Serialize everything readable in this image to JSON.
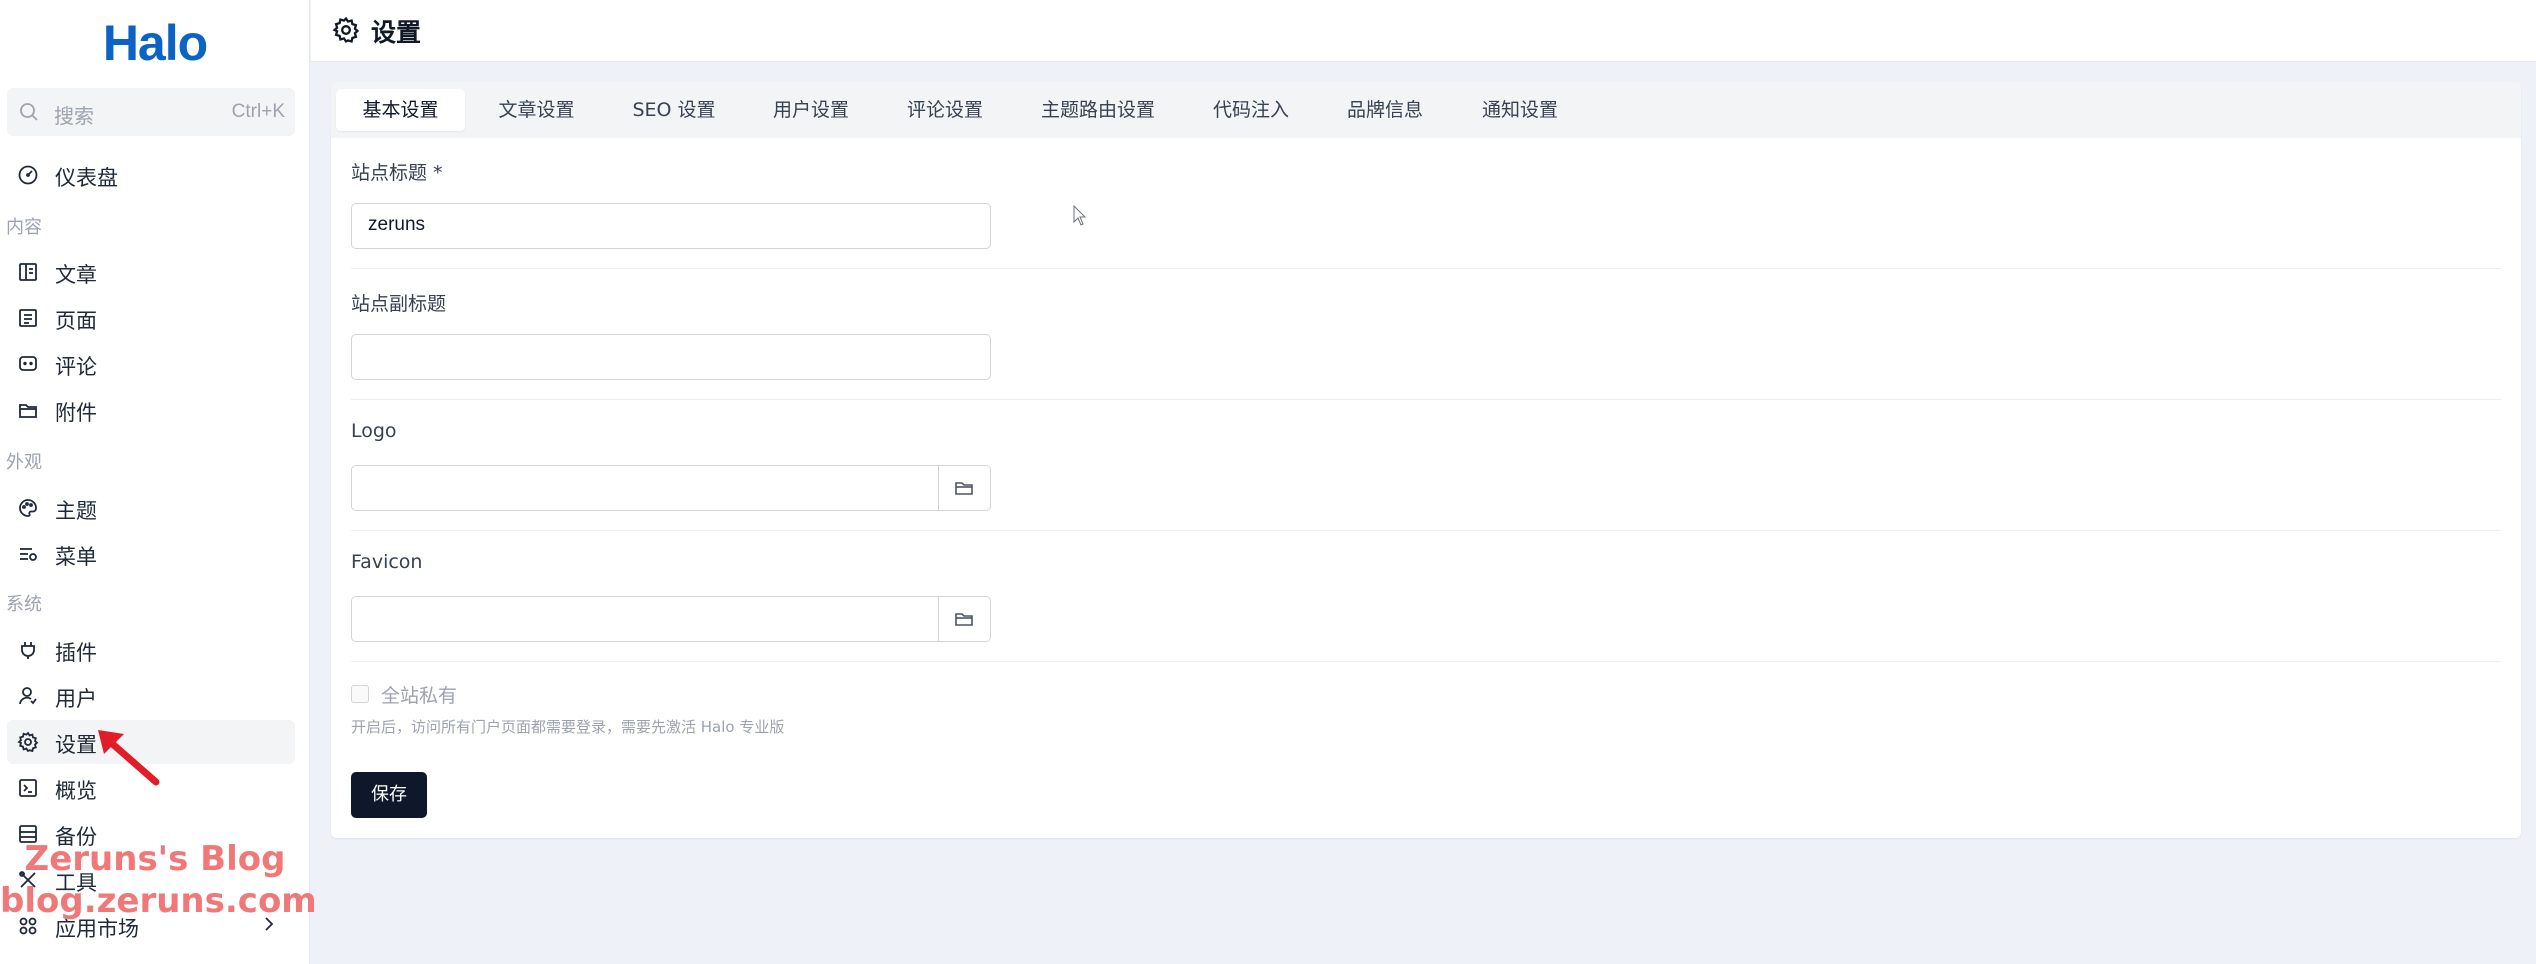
{
  "app": {
    "logo": "Halo"
  },
  "search": {
    "placeholder": "搜索",
    "shortcut": "Ctrl+K"
  },
  "sidebar": {
    "dashboard": {
      "label": "仪表盘",
      "icon": "dashboard-icon"
    },
    "groups": {
      "content": "内容",
      "appearance": "外观",
      "system": "系统"
    },
    "content_items": [
      {
        "label": "文章",
        "icon": "posts-icon"
      },
      {
        "label": "页面",
        "icon": "pages-icon"
      },
      {
        "label": "评论",
        "icon": "comments-icon"
      },
      {
        "label": "附件",
        "icon": "attachments-icon"
      }
    ],
    "appearance_items": [
      {
        "label": "主题",
        "icon": "palette-icon"
      },
      {
        "label": "菜单",
        "icon": "menu-list-icon"
      }
    ],
    "system_items": [
      {
        "label": "插件",
        "icon": "plug-icon"
      },
      {
        "label": "用户",
        "icon": "user-icon"
      },
      {
        "label": "设置",
        "icon": "gear-icon",
        "active": true
      },
      {
        "label": "概览",
        "icon": "terminal-icon"
      },
      {
        "label": "备份",
        "icon": "backup-icon"
      },
      {
        "label": "工具",
        "icon": "tools-icon"
      },
      {
        "label": "应用市场",
        "icon": "apps-icon"
      }
    ]
  },
  "watermark": {
    "line1": "Zeruns's Blog",
    "line2": "blog.zeruns.com"
  },
  "header": {
    "title": "设置",
    "icon": "gear-icon"
  },
  "tabs": [
    {
      "label": "基本设置",
      "active": true
    },
    {
      "label": "文章设置"
    },
    {
      "label": "SEO 设置"
    },
    {
      "label": "用户设置"
    },
    {
      "label": "评论设置"
    },
    {
      "label": "主题路由设置"
    },
    {
      "label": "代码注入"
    },
    {
      "label": "品牌信息"
    },
    {
      "label": "通知设置"
    }
  ],
  "form": {
    "site_title": {
      "label": "站点标题 *",
      "value": "zeruns"
    },
    "site_subtitle": {
      "label": "站点副标题",
      "value": ""
    },
    "logo": {
      "label": "Logo",
      "value": ""
    },
    "favicon": {
      "label": "Favicon",
      "value": ""
    },
    "private_site": {
      "label": "全站私有",
      "checked": false,
      "help": "开启后，访问所有门户页面都需要登录，需要先激活 Halo 专业版"
    },
    "save_label": "保存"
  },
  "colors": {
    "brand": "#0b63c6",
    "background": "#eef2f8",
    "primary_button": "#0f172a",
    "watermark": "#f07878",
    "annotation_arrow": "#e11d2a"
  }
}
